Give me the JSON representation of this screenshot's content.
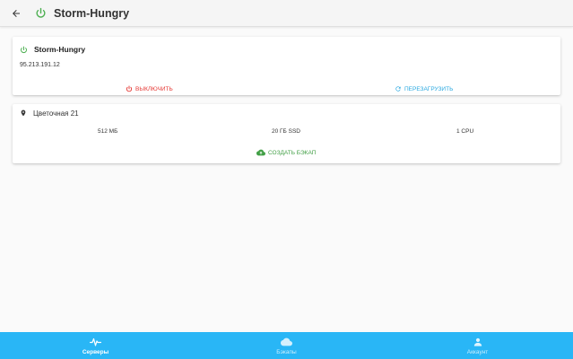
{
  "appbar": {
    "title": "Storm-Hungry",
    "back_icon": "arrow-left-icon",
    "power_icon": "power-icon"
  },
  "server_card": {
    "name": "Storm-Hungry",
    "ip": "95.213.191.12",
    "power_off_label": "ВЫКЛЮЧИТЬ",
    "reboot_label": "ПЕРЕЗАГРУЗИТЬ",
    "status_color": "#4caf50",
    "power_off_color": "#e53935",
    "reboot_color": "#29a8e0"
  },
  "plan_card": {
    "location": "Цветочная 21",
    "ram": "512 МБ",
    "disk": "20 ГБ SSD",
    "cpu": "1 CPU",
    "backup_label": "СОЗДАТЬ БЭКАП",
    "backup_color": "#43a047"
  },
  "bottom_nav": {
    "color": "#29b6f6",
    "items": [
      {
        "label": "Серверы",
        "icon": "pulse-icon",
        "active": true
      },
      {
        "label": "Бэкапы",
        "icon": "cloud-icon",
        "active": false
      },
      {
        "label": "Аккаунт",
        "icon": "person-icon",
        "active": false
      }
    ]
  }
}
